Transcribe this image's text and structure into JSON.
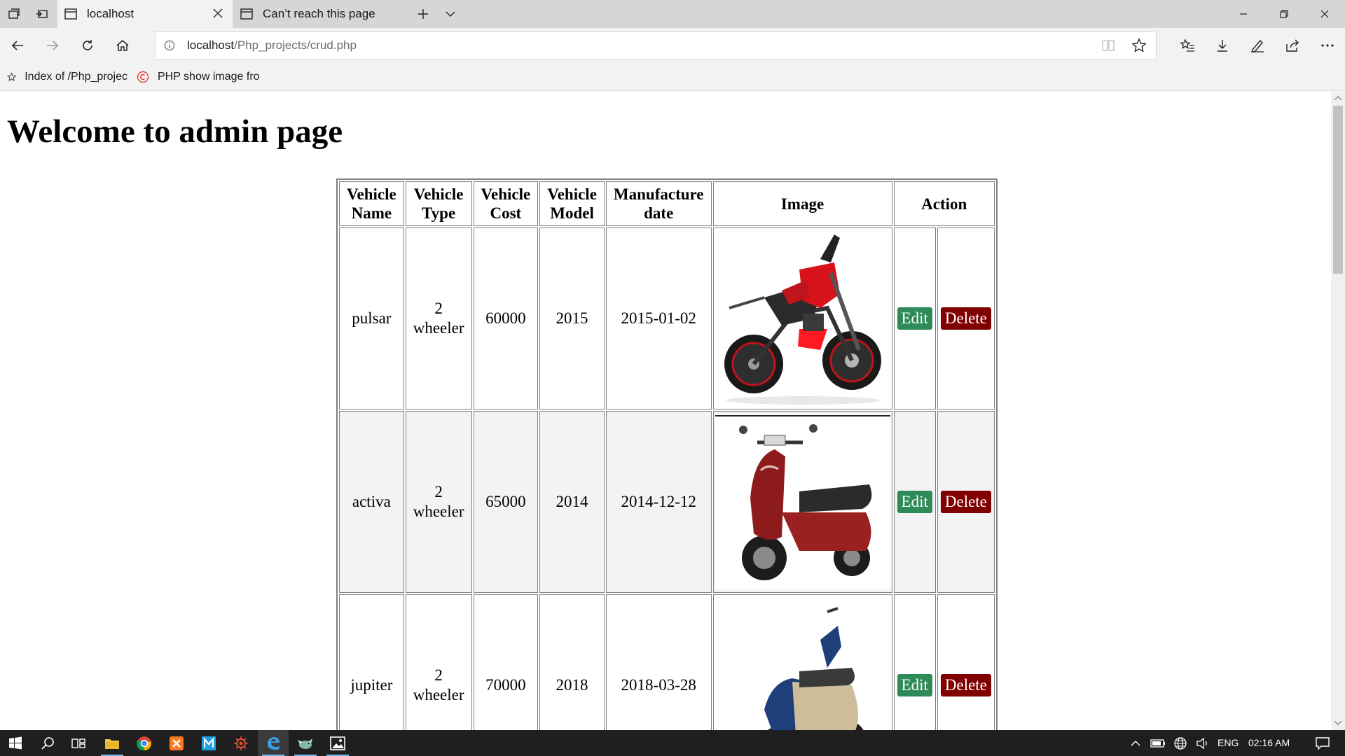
{
  "browser": {
    "tabs": [
      {
        "title": "localhost",
        "active": true
      },
      {
        "title": "Can’t reach this page",
        "active": false
      }
    ],
    "address": {
      "host": "localhost",
      "path": "/Php_projects/crud.php"
    },
    "favorites": [
      {
        "label": "Index of /Php_projec",
        "icon": "star-icon"
      },
      {
        "label": "PHP show image fro",
        "icon": "copyright-icon"
      }
    ]
  },
  "page": {
    "title": "Welcome to admin page",
    "table": {
      "headers": {
        "name": "Vehicle Name",
        "type": "Vehicle Type",
        "cost": "Vehicle Cost",
        "model": "Vehicle Model",
        "date": "Manufacture date",
        "image": "Image",
        "action": "Action"
      },
      "rows": [
        {
          "name": "pulsar",
          "type": "2 wheeler",
          "cost": "60000",
          "model": "2015",
          "date": "2015-01-02",
          "image": "red-black sport motorcycle",
          "edit": "Edit",
          "delete": "Delete"
        },
        {
          "name": "activa",
          "type": "2 wheeler",
          "cost": "65000",
          "model": "2014",
          "date": "2014-12-12",
          "image": "maroon scooter",
          "edit": "Edit",
          "delete": "Delete"
        },
        {
          "name": "jupiter",
          "type": "2 wheeler",
          "cost": "70000",
          "model": "2018",
          "date": "2018-03-28",
          "image": "blue scooter",
          "edit": "Edit",
          "delete": "Delete"
        }
      ]
    }
  },
  "taskbar": {
    "language": "ENG",
    "time": "02:16 AM",
    "apps": [
      "file-explorer-icon",
      "chrome-icon",
      "xampp-icon",
      "m-app-icon",
      "settings-app-icon",
      "edge-icon",
      "bird-app-icon",
      "photos-icon"
    ],
    "colors": {
      "accent": "#76b9ed",
      "edit_button": "#2e8b57",
      "delete_button": "#800000"
    }
  }
}
